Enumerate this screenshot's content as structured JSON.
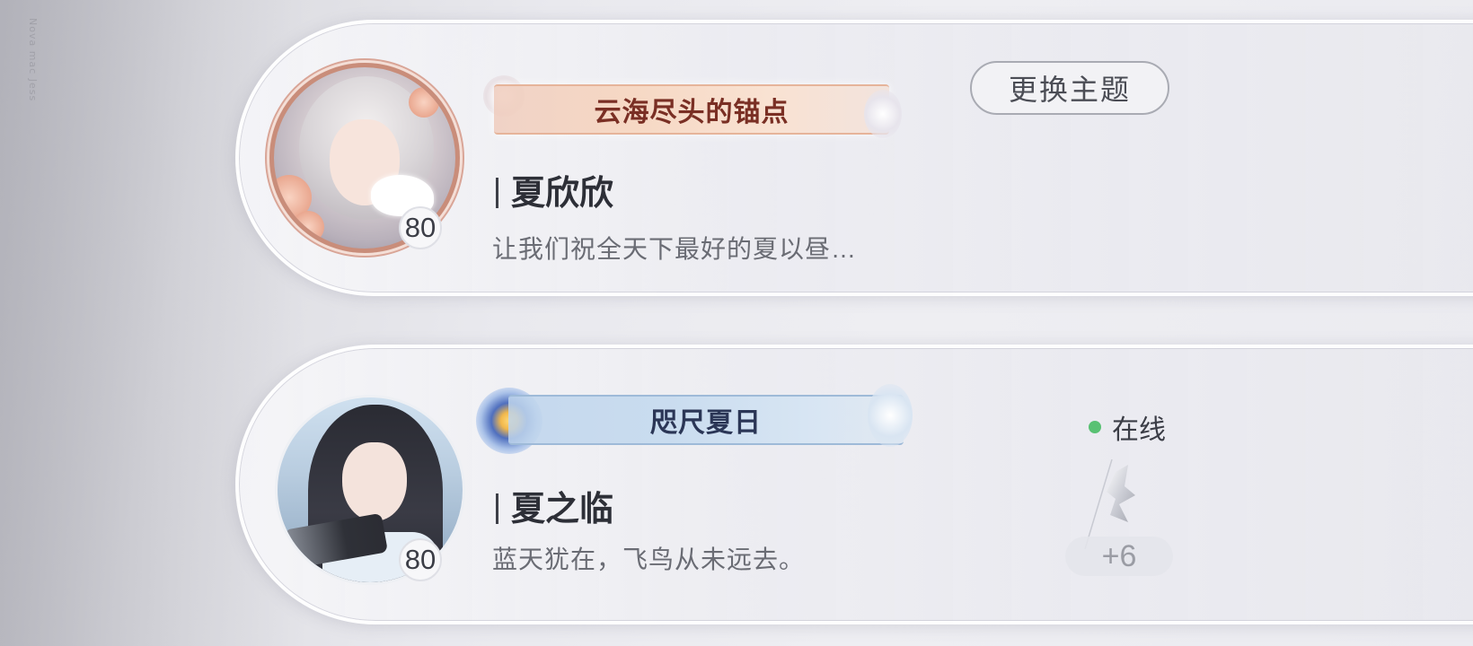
{
  "watermark": "Nova mac Jess",
  "colors": {
    "online_dot": "#59c173",
    "card_background": "#ebebf0",
    "banner_warm_text": "#7a2f24",
    "banner_cool_text": "#2b3656"
  },
  "friends": [
    {
      "title_banner": "云海尽头的锚点",
      "name": "夏欣欣",
      "level": "80",
      "signature": "让我们祝全天下最好的夏以昼…",
      "action_button": "更换主题",
      "avatar_icon": "white-haired-character-with-dove-icon"
    },
    {
      "title_banner": "咫尺夏日",
      "name": "夏之临",
      "level": "80",
      "signature": "蓝天犹在，飞鸟从未远去。",
      "status": "在线",
      "extra_count": "+6",
      "avatar_icon": "dark-haired-character-icon",
      "badge_icon": "silver-figure-badge-icon"
    }
  ]
}
